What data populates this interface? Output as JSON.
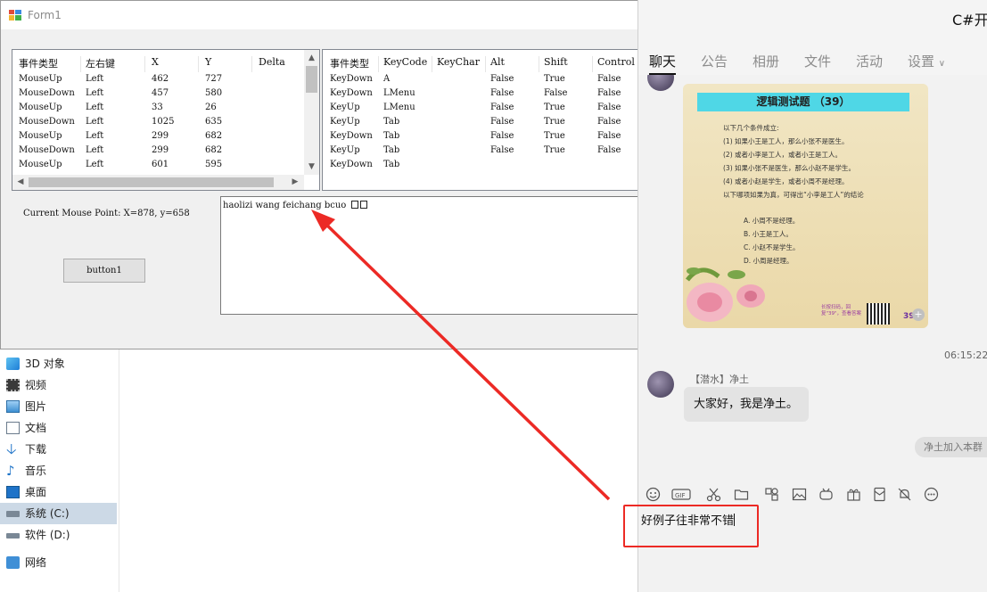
{
  "form": {
    "title": "Form1",
    "mouse_grid": {
      "headers": [
        "事件类型",
        "左右键",
        "X",
        "Y",
        "Delta"
      ],
      "rows": [
        [
          "MouseUp",
          "Left",
          "462",
          "727"
        ],
        [
          "MouseDown",
          "Left",
          "457",
          "580"
        ],
        [
          "MouseUp",
          "Left",
          "33",
          "26"
        ],
        [
          "MouseDown",
          "Left",
          "1025",
          "635"
        ],
        [
          "MouseUp",
          "Left",
          "299",
          "682"
        ],
        [
          "MouseDown",
          "Left",
          "299",
          "682"
        ],
        [
          "MouseUp",
          "Left",
          "601",
          "595"
        ]
      ]
    },
    "key_grid": {
      "headers": [
        "事件类型",
        "KeyCode",
        "KeyChar",
        "Alt",
        "Shift",
        "Control"
      ],
      "rows": [
        [
          "KeyDown",
          "A",
          "",
          "False",
          "True",
          "False"
        ],
        [
          "KeyDown",
          "LMenu",
          "",
          "False",
          "False",
          "False"
        ],
        [
          "KeyUp",
          "LMenu",
          "",
          "False",
          "True",
          "False"
        ],
        [
          "KeyUp",
          "Tab",
          "",
          "False",
          "True",
          "False"
        ],
        [
          "KeyDown",
          "Tab",
          "",
          "False",
          "True",
          "False"
        ],
        [
          "KeyUp",
          "Tab",
          "",
          "False",
          "True",
          "False"
        ],
        [
          "KeyDown",
          "Tab",
          "",
          "",
          "",
          ""
        ]
      ]
    },
    "mouse_point_label": "Current Mouse Point: X=878, y=658",
    "button_label": "button1",
    "textbox_value": "haolizi wang feichang bcuo"
  },
  "explorer": {
    "items": [
      {
        "label": "3D 对象",
        "icon": "3d-objects-icon"
      },
      {
        "label": "视频",
        "icon": "video-icon"
      },
      {
        "label": "图片",
        "icon": "pictures-icon"
      },
      {
        "label": "文档",
        "icon": "documents-icon"
      },
      {
        "label": "下载",
        "icon": "downloads-icon"
      },
      {
        "label": "音乐",
        "icon": "music-icon"
      },
      {
        "label": "桌面",
        "icon": "desktop-icon"
      },
      {
        "label": "系统 (C:)",
        "icon": "drive-icon"
      },
      {
        "label": "软件 (D:)",
        "icon": "drive-icon"
      },
      {
        "label": "网络",
        "icon": "network-icon"
      }
    ]
  },
  "chat": {
    "title": "C#开",
    "tabs": [
      "聊天",
      "公告",
      "相册",
      "文件",
      "活动",
      "设置"
    ],
    "poster": {
      "title": "逻辑测试题 （39）",
      "lines": [
        "以下几个条件成立:",
        "(1) 如果小王是工人，那么小张不是医生。",
        "(2) 或者小李是工人，或者小王是工人。",
        "(3) 如果小张不是医生，那么小赵不是学生。",
        "(4) 或者小赵是学生，或者小周不是经理。",
        "以下哪项如果为真，可得出“小李是工人”的结论"
      ],
      "options": [
        "A.  小周不是经理。",
        "B.  小王是工人。",
        "C.  小赵不是学生。",
        "D.  小周是经理。"
      ],
      "note": "长按扫码，回复\"39\"，查看答案",
      "number": "39"
    },
    "timestamp": "06:15:22",
    "sender": "【潜水】净土",
    "message": "大家好，我是净土。",
    "system_notice": "净土加入本群",
    "input_value": "好例子往非常不错"
  },
  "colors": {
    "annotation": "#ec2a25",
    "selected_nav": "#ccd9e6"
  }
}
